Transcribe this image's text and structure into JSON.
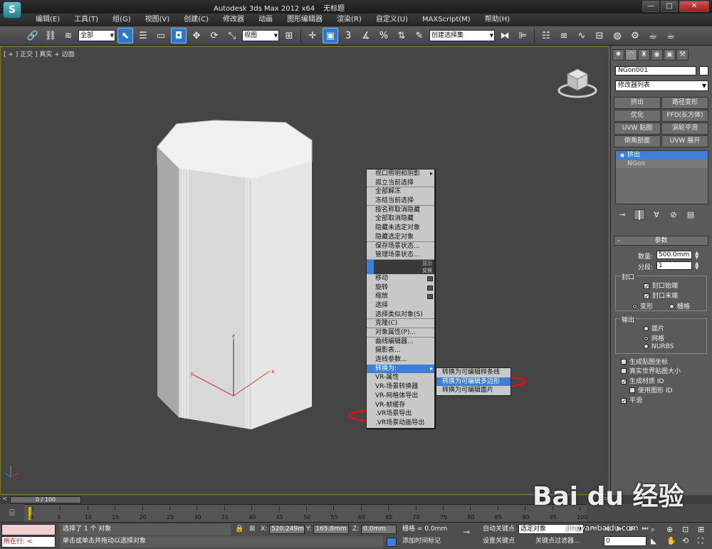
{
  "app": {
    "logo": "S",
    "title_parts": [
      "Autodesk 3ds Max  2012 x64",
      "无标题"
    ],
    "window_controls": [
      "—",
      "□",
      "✕"
    ]
  },
  "menu": [
    "编辑(E)",
    "工具(T)",
    "组(G)",
    "视图(V)",
    "创建(C)",
    "修改器",
    "动画",
    "图形编辑器",
    "渲染(R)",
    "自定义(U)",
    "MAXScript(M)",
    "帮助(H)"
  ],
  "toolbar": {
    "selection_filter": "全部",
    "ref_coord": "视图",
    "named_selection": "创建选择集",
    "snap_labels": [
      "3",
      "%"
    ],
    "icons": [
      "link-icon",
      "unlink-icon",
      "bind-icon",
      "select-icon",
      "select-by-name-icon",
      "rect-region-icon",
      "window-crossing-icon",
      "move-icon",
      "rotate-icon",
      "scale-icon",
      "pivot-icon",
      "snap-icon",
      "angle-snap-icon",
      "percent-snap-icon",
      "spinner-snap-icon",
      "edit-named-icon",
      "mirror-icon",
      "align-icon",
      "layer-icon",
      "curve-editor-icon",
      "schematic-icon",
      "material-editor-icon",
      "render-setup-icon",
      "render-frame-icon",
      "render-icon"
    ]
  },
  "viewport": {
    "label": "[ + ] 正交 ] 真实 + 边面",
    "axis_labels": [
      "y",
      "z",
      "x"
    ]
  },
  "context_menu": {
    "items": [
      {
        "label": "视口照明和阴影",
        "arrow": true
      },
      {
        "label": "孤立当前选择",
        "sep": true
      },
      {
        "label": "全部解冻"
      },
      {
        "label": "冻结当前选择",
        "sep": true
      },
      {
        "label": "按名称取消隐藏"
      },
      {
        "label": "全部取消隐藏"
      },
      {
        "label": "隐藏未选定对象"
      },
      {
        "label": "隐藏选定对象",
        "sep": true
      },
      {
        "label": "保存场景状态..."
      },
      {
        "label": "管理场景状态...",
        "sep": true
      }
    ],
    "quad_labels": [
      "显示",
      "变换"
    ],
    "transform_items": [
      {
        "label": "移动",
        "box": true
      },
      {
        "label": "旋转",
        "box": true
      },
      {
        "label": "缩放",
        "box": true
      },
      {
        "label": "选择"
      },
      {
        "label": "选择类似对象(S)",
        "sep": true
      },
      {
        "label": "克隆(C)",
        "sep": true
      },
      {
        "label": "对象属性(P)...",
        "sep": true
      },
      {
        "label": "曲线编辑器..."
      },
      {
        "label": "摄影表..."
      },
      {
        "label": "连线参数..."
      },
      {
        "label": "转换为:",
        "arrow": true,
        "highlight": true
      },
      {
        "label": "VR-属性"
      },
      {
        "label": "VR-场景转换器"
      },
      {
        "label": "VR-网格体导出"
      },
      {
        "label": "VR-帧缓存"
      },
      {
        "label": ".VR场景导出"
      },
      {
        "label": ".VR场景动画导出"
      }
    ],
    "submenu": [
      {
        "label": "转换为可编辑样条线"
      },
      {
        "label": "转换为可编辑多边形",
        "highlight": true
      },
      {
        "label": "转换为可编辑面片"
      }
    ],
    "annotation_color": "#e01010"
  },
  "command_panel": {
    "tabs": [
      "✹",
      "◠",
      "♜",
      "◉",
      "▣",
      "⚒"
    ],
    "object_name": "NGon001",
    "modifier_list": "修改器列表",
    "modifier_buttons": [
      "挤出",
      "路径变形",
      "优化",
      "FFD(长方体)",
      "UVW 贴图",
      "涡轮平滑",
      "倒角剖面",
      "UVW 展开"
    ],
    "stack": [
      "挤出",
      "NGon"
    ],
    "params_title": "参数",
    "amount_label": "数量:",
    "amount_value": "500.0mm",
    "segments_label": "分段:",
    "segments_value": "1",
    "capping_title": "封口",
    "cap_start": "封口始端",
    "cap_end": "封口末端",
    "morph": "变形",
    "grid": "栅格",
    "output_title": "输出",
    "out_patch": "面片",
    "out_mesh": "网格",
    "out_nurbs": "NURBS",
    "gen_map_coords": "生成贴图坐标",
    "real_world_map": "真实世界贴图大小",
    "gen_mat_ids": "生成材质 ID",
    "use_shape_ids": "使用图形 ID",
    "smooth": "平滑"
  },
  "timeline": {
    "slider": "0 / 100",
    "ticks": [
      "0",
      "5",
      "10",
      "15",
      "20",
      "25",
      "30",
      "35",
      "40",
      "45",
      "50",
      "55",
      "60",
      "65",
      "70",
      "75",
      "80",
      "85",
      "90",
      "95",
      "100"
    ]
  },
  "status": {
    "maxscript": "所在行: <",
    "message1": "选择了 1 个 对象",
    "message2": "单击或单击并拖动以选择对象",
    "x_label": "X:",
    "x_value": "520.249m",
    "y_label": "Y:",
    "y_value": "165.8mm",
    "z_label": "Z:",
    "z_value": "0.0mm",
    "grid": "栅格 = 0.0mm",
    "add_time_tag": "添加时间标记",
    "auto_key": "自动关键点",
    "key_target": "选定对象",
    "set_key": "设置关键点",
    "key_filters": "关键点过滤器...",
    "frame": "0"
  },
  "watermark": {
    "text": "Bai du 经验",
    "url": "jingyan.baidu.com"
  }
}
